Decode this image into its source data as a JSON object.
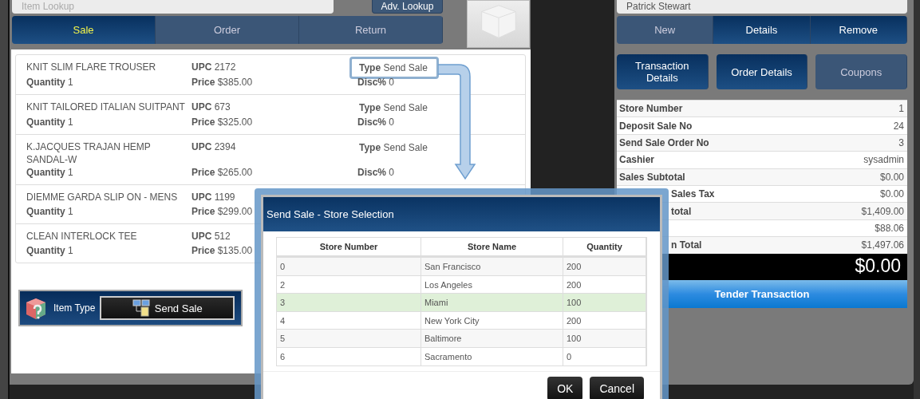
{
  "item_lookup": {
    "placeholder": "Item Lookup",
    "button": "Adv. Lookup"
  },
  "mode_tabs": [
    {
      "label": "Sale",
      "selected": true
    },
    {
      "label": "Order",
      "selected": false
    },
    {
      "label": "Return",
      "selected": false
    }
  ],
  "items": [
    {
      "name": "KNIT SLIM FLARE TROUSER",
      "quantity": "**Quantity** 1",
      "upc": "**UPC** 2172",
      "price": "**Price** $385.00",
      "type": "**Type** Send Sale",
      "disc": "**Disc%** 0",
      "highlighted": true
    },
    {
      "name": "KNIT TAILORED ITALIAN SUITPANT",
      "quantity": "**Quantity** 1",
      "upc": "**UPC** 673",
      "price": "**Price** $325.00",
      "type": "**Type** Send Sale",
      "disc": "**Disc%** 0",
      "highlighted": false
    },
    {
      "name": "K.JACQUES TRAJAN HEMP SANDAL-W",
      "quantity": "**Quantity** 1",
      "upc": "**UPC** 2394",
      "price": "**Price** $265.00",
      "type": "**Type** Send Sale",
      "disc": "**Disc%** 0",
      "highlighted": false
    },
    {
      "name": "DIEMME GARDA SLIP ON - MENS",
      "quantity": "**Quantity** 1",
      "upc": "**UPC** 1199",
      "price": "**Price** $299.00"
    },
    {
      "name": "CLEAN INTERLOCK TEE",
      "quantity": "**Quantity** 1",
      "upc": "**UPC** 512",
      "price": "**Price** $135.00"
    }
  ],
  "item_type": {
    "label": "Item Type",
    "value": "Send Sale"
  },
  "customer": {
    "value": "Patrick Stewart"
  },
  "customer_buttons": [
    {
      "label": "New",
      "disabled": true
    },
    {
      "label": "Details",
      "disabled": false
    },
    {
      "label": "Remove",
      "disabled": false
    }
  ],
  "detail_buttons": [
    {
      "label": "Transaction Details",
      "disabled": false
    },
    {
      "label": "Order Details",
      "disabled": false
    },
    {
      "label": "Coupons",
      "disabled": true
    }
  ],
  "summary": [
    {
      "label": "Store Number",
      "value": "1",
      "covered": false
    },
    {
      "label": "Deposit Sale No",
      "value": "24",
      "covered": false
    },
    {
      "label": "Send Sale Order No",
      "value": "3",
      "covered": false
    },
    {
      "label": "Cashier",
      "value": "sysadmin",
      "covered": false
    },
    {
      "label": "Sales Subtotal",
      "value": "$0.00",
      "covered": false
    },
    {
      "label": "Sales Tax",
      "value": "$0.00",
      "covered": true
    },
    {
      "label": "total",
      "value": "$1,409.00",
      "covered": true
    },
    {
      "value": "$88.06"
    },
    {
      "label": "n Total",
      "value": "$1,497.06",
      "covered": true
    }
  ],
  "balance": "$0.00",
  "tender_button": "Tender Transaction",
  "dialog": {
    "title": "Send Sale - Store Selection",
    "columns": [
      "Store Number",
      "Store Name",
      "Quantity"
    ],
    "rows": [
      {
        "cells": [
          "0",
          "San Francisco",
          "200"
        ],
        "selected": false
      },
      {
        "cells": [
          "2",
          "Los Angeles",
          "200"
        ],
        "selected": false
      },
      {
        "cells": [
          "3",
          "Miami",
          "100"
        ],
        "selected": true
      },
      {
        "cells": [
          "4",
          "New York City",
          "200"
        ],
        "selected": false
      },
      {
        "cells": [
          "5",
          "Baltimore",
          "100"
        ],
        "selected": false
      },
      {
        "cells": [
          "6",
          "Sacramento",
          "0"
        ],
        "selected": false
      }
    ],
    "buttons": [
      "OK",
      "Cancel"
    ]
  }
}
